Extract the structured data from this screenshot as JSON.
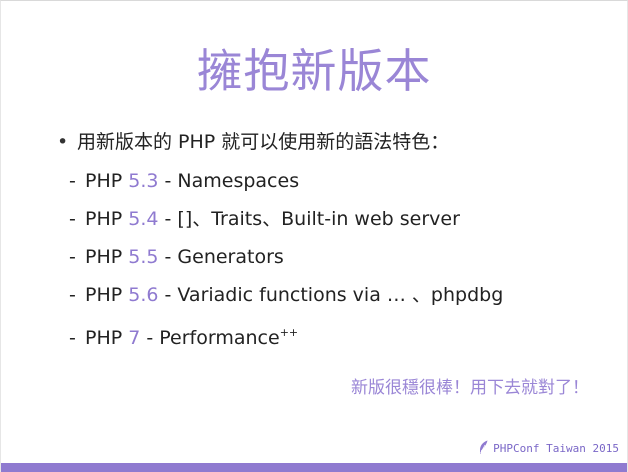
{
  "slide": {
    "title": "擁抱新版本",
    "lead": "用新版本的 PHP 就可以使用新的語法特色：",
    "items": [
      {
        "prefix": "PHP ",
        "version": "5.3",
        "desc": " - Namespaces"
      },
      {
        "prefix": "PHP ",
        "version": "5.4",
        "desc": " - []、Traits、Built-in web server"
      },
      {
        "prefix": "PHP ",
        "version": "5.5",
        "desc": " - Generators"
      },
      {
        "prefix": "PHP ",
        "version": "5.6",
        "desc": " - Variadic functions via … 、phpdbg"
      },
      {
        "prefix": "PHP ",
        "version": "7",
        "desc": " - Performance",
        "sup": "++"
      }
    ],
    "punchline": "新版很穩很棒！用下去就對了！",
    "footer": "PHPConf Taiwan 2015"
  },
  "colors": {
    "accent": "#9a86d6",
    "footer_bar": "#8f7ad0"
  },
  "icons": {
    "footer_logo": "feather-icon"
  }
}
